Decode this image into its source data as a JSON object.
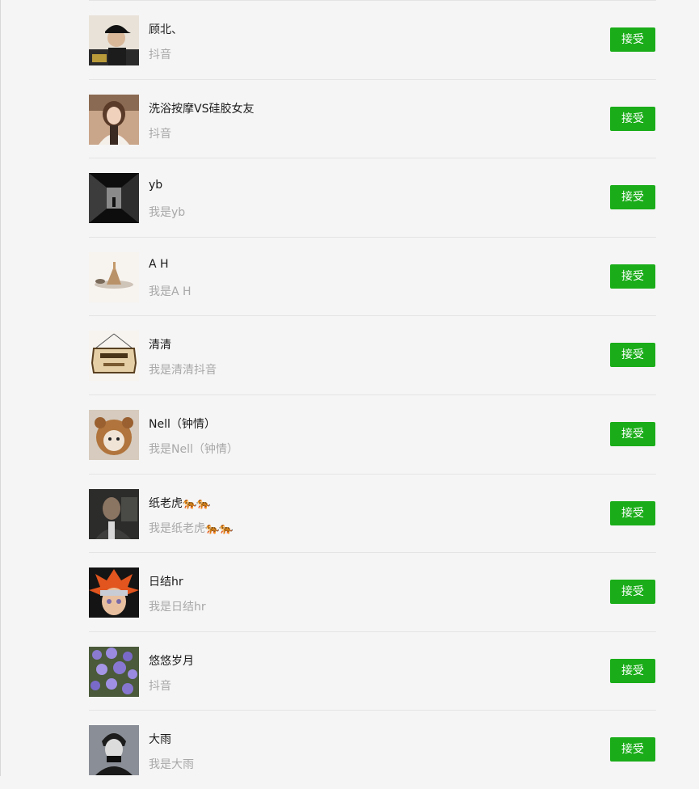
{
  "friend_requests": [
    {
      "name": "顾北、",
      "message": "抖音",
      "avatar": "avatar-man-cap-icon",
      "action": "接受"
    },
    {
      "name": "洗浴按摩VS硅胶女友",
      "message": "抖音",
      "avatar": "avatar-woman-icon",
      "action": "接受"
    },
    {
      "name": "yb",
      "message": "我是yb",
      "avatar": "avatar-corridor-icon",
      "action": "接受"
    },
    {
      "name": "A  H",
      "message": "我是A  H",
      "avatar": "avatar-landscape-icon",
      "action": "接受"
    },
    {
      "name": "清清",
      "message": " 我是清清抖音",
      "avatar": "avatar-sign-icon",
      "action": "接受"
    },
    {
      "name": "Nell（钟情）",
      "message": "我是Nell（钟情）",
      "avatar": "avatar-kitten-icon",
      "action": "接受"
    },
    {
      "name": "纸老虎🐅🐅",
      "message": "我是纸老虎🐅🐅",
      "avatar": "avatar-man-suit-icon",
      "action": "接受"
    },
    {
      "name": "日结hr",
      "message": "我是日结hr",
      "avatar": "avatar-anime-icon",
      "action": "接受"
    },
    {
      "name": "悠悠岁月",
      "message": "抖音",
      "avatar": "avatar-flowers-icon",
      "action": "接受"
    },
    {
      "name": "大雨",
      "message": "我是大雨",
      "avatar": "avatar-sketch-icon",
      "action": "接受"
    }
  ],
  "colors": {
    "accept_button": "#1aad19",
    "name_text": "#1a1a1a",
    "message_text": "#a8a8a8",
    "background": "#f5f5f5"
  }
}
